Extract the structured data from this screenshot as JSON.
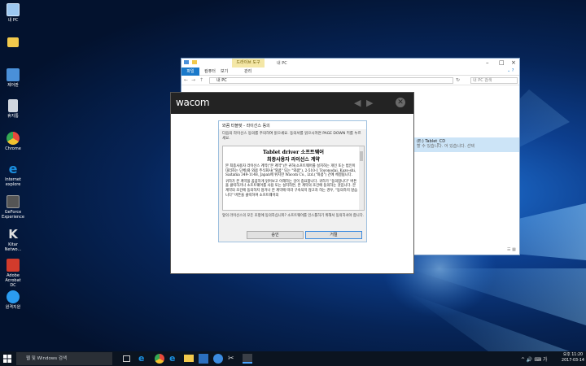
{
  "desktop": {
    "icons": [
      {
        "label": "내 PC",
        "color": "#9cc7f0"
      },
      {
        "label": "",
        "color": "#f2c94c"
      },
      {
        "label": "제어판",
        "color": "#4a90d9"
      },
      {
        "label": "휴지통",
        "color": "#d0d6de"
      },
      {
        "label": "Chrome",
        "color": "#e84a3c"
      },
      {
        "label": "Internet explore",
        "color": "#1a8fe0"
      },
      {
        "label": "GeForce Experience",
        "color": "#7a7a7a"
      },
      {
        "label": "Kitar Netwo...",
        "color": "#e0e0e0"
      },
      {
        "label": "Adobe Acrobat DC",
        "color": "#d23b2c"
      },
      {
        "label": "원격지원",
        "color": "#2b9cf0"
      }
    ]
  },
  "explorer": {
    "tools_tab": "드라이브 도구",
    "title": "내 PC",
    "ribbon": {
      "file": "파일",
      "computer": "컴퓨터",
      "view": "보기",
      "manage": "관리"
    },
    "address": "내 PC",
    "search_placeholder": "내 PC 검색",
    "selected_item": "(E:) Tablet_CD",
    "selected_sub": "할 수 있습니다. 어 있습니다. 선택",
    "status": ""
  },
  "wacom": {
    "logo": "wacom",
    "back_label": "◀",
    "forward_label": "▶",
    "close_label": "✕"
  },
  "dialog": {
    "title": "와콤 타블렛 - 라이선스 동의",
    "instructions": "다음의 라이선스 동의를 주의하여 읽으세요. 동의서를 읽으시려면 PAGE DOWN 키를 누르세요.",
    "license_title": "Tablet driver 소프트웨어",
    "license_subtitle": "최종사용자 라이선스 계약",
    "license_p1": "본 최종사용자 라이선스 계약(\"본 계약\")은 귀하(소프트웨어를 설치하는 개인 또는 법인이 대리하는 단체)와 와콤 주식회사(\"와콤\" 또는 \"와콤\"), 2-510-1 Toyonodai, Kazo-shi, Saitama 349-1148, Japan에 위치한 Wacom Co., Ltd.(\"와콤\") 간에 체결됩니다.",
    "license_p2": "귀하가 본 계약을 꼼꼼하게 읽어보고 이해하는 것이 중요합니다. 귀하가 \"동의합니다\" 버튼을 클릭하거나 소프트웨어를 사용 또는 설치하면, 본 계약의 조건에 동의하는 것입니다. 본 계약의 조건에 동의하지 않거나 본 계약에 따라 구속되지 않고자 하는 경우, \"동의하지 않습니다\" 버튼을 클릭하여 소프트웨어의",
    "question": "앞의 라이선스의 모든 조항에 동의하십니까? 소프트웨어를 인스톨하기 위해서 동의하셔야 합니다.",
    "accept_label": "승인",
    "decline_label": "거절"
  },
  "taskbar": {
    "search_placeholder": "웹 및 Windows 검색",
    "time": "오후 11:20",
    "date": "2017-03-14",
    "tray_text": "^ 🔊 ⌨ 가"
  },
  "colors": {
    "wacom_header": "#232323",
    "selection": "#cce4f7",
    "accent": "#1979ca"
  }
}
